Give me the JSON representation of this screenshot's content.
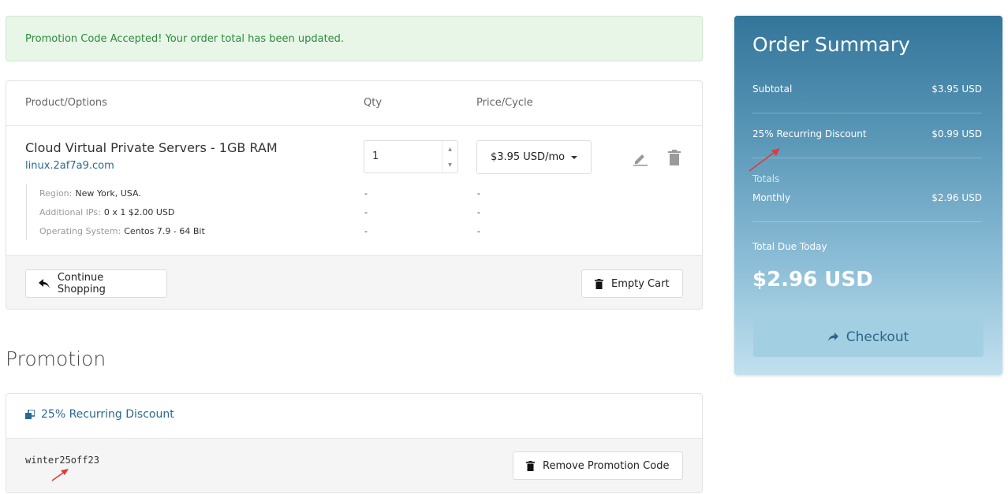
{
  "alert": {
    "message": "Promotion Code Accepted! Your order total has been updated."
  },
  "cart": {
    "headers": {
      "product": "Product/Options",
      "qty": "Qty",
      "price": "Price/Cycle"
    },
    "item": {
      "title": "Cloud Virtual Private Servers - 1GB RAM",
      "domain": "linux.2af7a9.com",
      "qty": "1",
      "price": "$3.95 USD/mo",
      "options": [
        {
          "label": "Region:",
          "value": "New York, USA.",
          "qty": "-",
          "price": "-"
        },
        {
          "label": "Additional IPs:",
          "value": "0 x 1 $2.00 USD",
          "qty": "-",
          "price": "-"
        },
        {
          "label": "Operating System:",
          "value": "Centos 7.9 - 64 Bit",
          "qty": "-",
          "price": "-"
        }
      ]
    },
    "continue_label": "Continue Shopping",
    "empty_label": "Empty Cart"
  },
  "promotion": {
    "heading": "Promotion",
    "title": "25% Recurring Discount",
    "code": "winter25off23",
    "remove_label": "Remove Promotion Code"
  },
  "summary": {
    "title": "Order Summary",
    "subtotal_label": "Subtotal",
    "subtotal_value": "$3.95 USD",
    "discount_label": "25% Recurring Discount",
    "discount_value": "$0.99 USD",
    "totals_label": "Totals",
    "monthly_label": "Monthly",
    "monthly_value": "$2.96 USD",
    "due_label": "Total Due Today",
    "due_value": "$2.96 USD",
    "checkout_label": "Checkout"
  },
  "colors": {
    "accent": "#2a6a8e",
    "success": "#2e8b3e",
    "annotation": "#e53935"
  }
}
